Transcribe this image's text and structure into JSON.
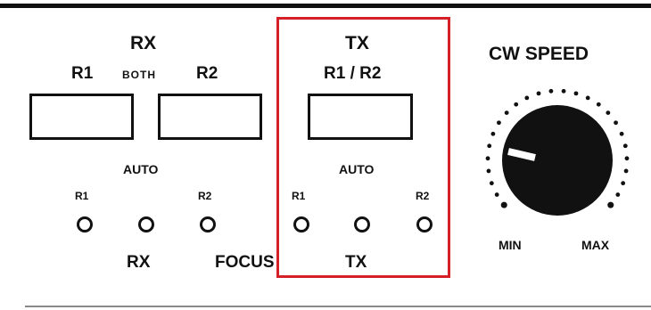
{
  "panel": {
    "rx_title": "RX",
    "rx_r1": "R1",
    "rx_both": "BOTH",
    "rx_r2": "R2",
    "tx_title": "TX",
    "tx_r1r2": "R1 / R2",
    "cw_speed": "CW SPEED",
    "auto_left": "AUTO",
    "auto_right": "AUTO",
    "led_r1_left": "R1",
    "led_r2_left": "R2",
    "led_r1_right": "R1",
    "led_r2_right": "R2",
    "bottom_rx": "RX",
    "bottom_focus": "FOCUS",
    "bottom_tx": "TX",
    "min": "MIN",
    "max": "MAX"
  },
  "colors": {
    "highlight": "#d42026",
    "ink": "#111111"
  }
}
